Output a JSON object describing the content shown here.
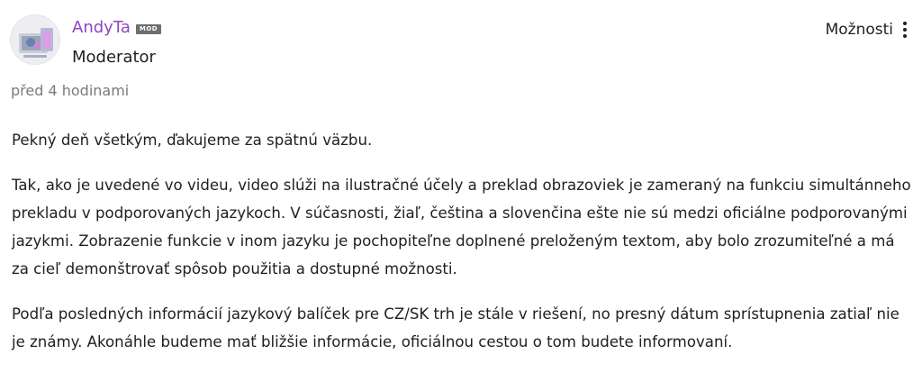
{
  "post": {
    "author": {
      "name": "AndyTa",
      "badge": "MOD",
      "role": "Moderator",
      "avatar_icon": "avatar-image"
    },
    "timestamp": "před 4 hodinami",
    "options": {
      "label": "Možnosti",
      "icon": "kebab-menu-icon"
    },
    "paragraphs": [
      "Pekný deň všetkým, ďakujeme za spätnú väzbu.",
      "Tak, ako je uvedené vo videu, video slúži na ilustračné účely a preklad obrazoviek je zameraný na funkciu simultánneho prekladu v podporovaných jazykoch. V súčasnosti, žiaľ, čeština a slovenčina ešte nie sú medzi oficiálne podporovanými jazykmi. Zobrazenie funkcie v inom jazyku je pochopiteľne doplnené preloženým textom, aby bolo zrozumiteľné a má za cieľ demonštrovať spôsob použitia a dostupné možnosti.",
      "Podľa posledných informácií jazykový balíček pre CZ/SK trh je stále v riešení, no presný dátum sprístupnenia zatiaľ nie je známy. Akonáhle budeme mať bližšie informácie, oficiálnou cestou o tom budete informovaní."
    ]
  },
  "colors": {
    "author_name": "#8e44c4",
    "badge_bg": "#6e6e6e",
    "text": "#1f1f1f",
    "muted": "#7a7a7a"
  }
}
